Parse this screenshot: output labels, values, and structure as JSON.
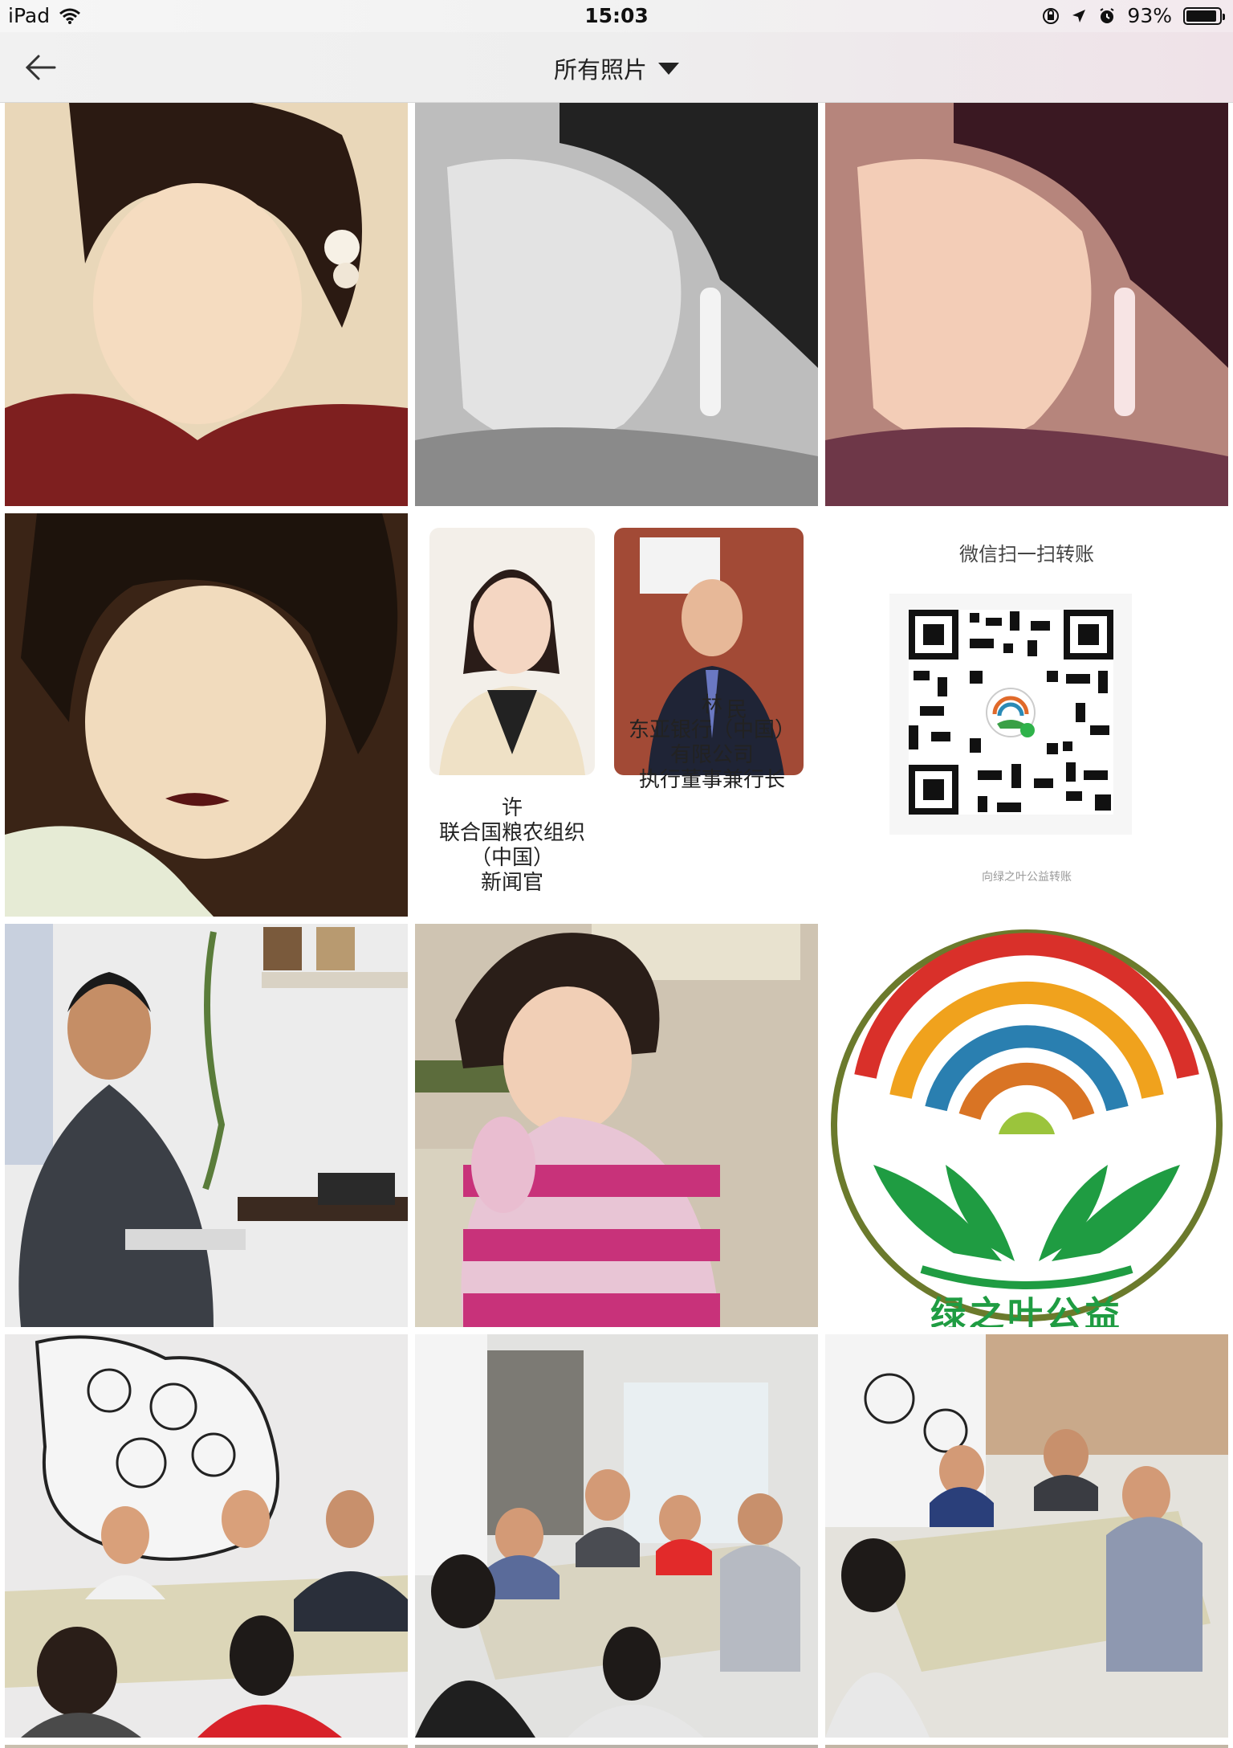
{
  "status_bar": {
    "device": "iPad",
    "time": "15:03",
    "battery": "93%",
    "battery_level": 0.93
  },
  "nav": {
    "title": "所有照片",
    "back_icon": "arrow-left-icon",
    "dropdown_icon": "caret-down-icon"
  },
  "photos": {
    "card_left": {
      "name": "许",
      "lines": [
        "联合国粮农组织",
        "（中国）",
        "新闻官"
      ]
    },
    "card_right": {
      "name": "林",
      "name_tail": "民",
      "lines": [
        "东亚银行（中国）",
        "有限公司",
        "执行董事兼行长"
      ]
    },
    "qr": {
      "title": "微信扫一扫转账",
      "caption": "向绿之叶公益转账"
    },
    "logo_text": "绿之叶公益"
  }
}
